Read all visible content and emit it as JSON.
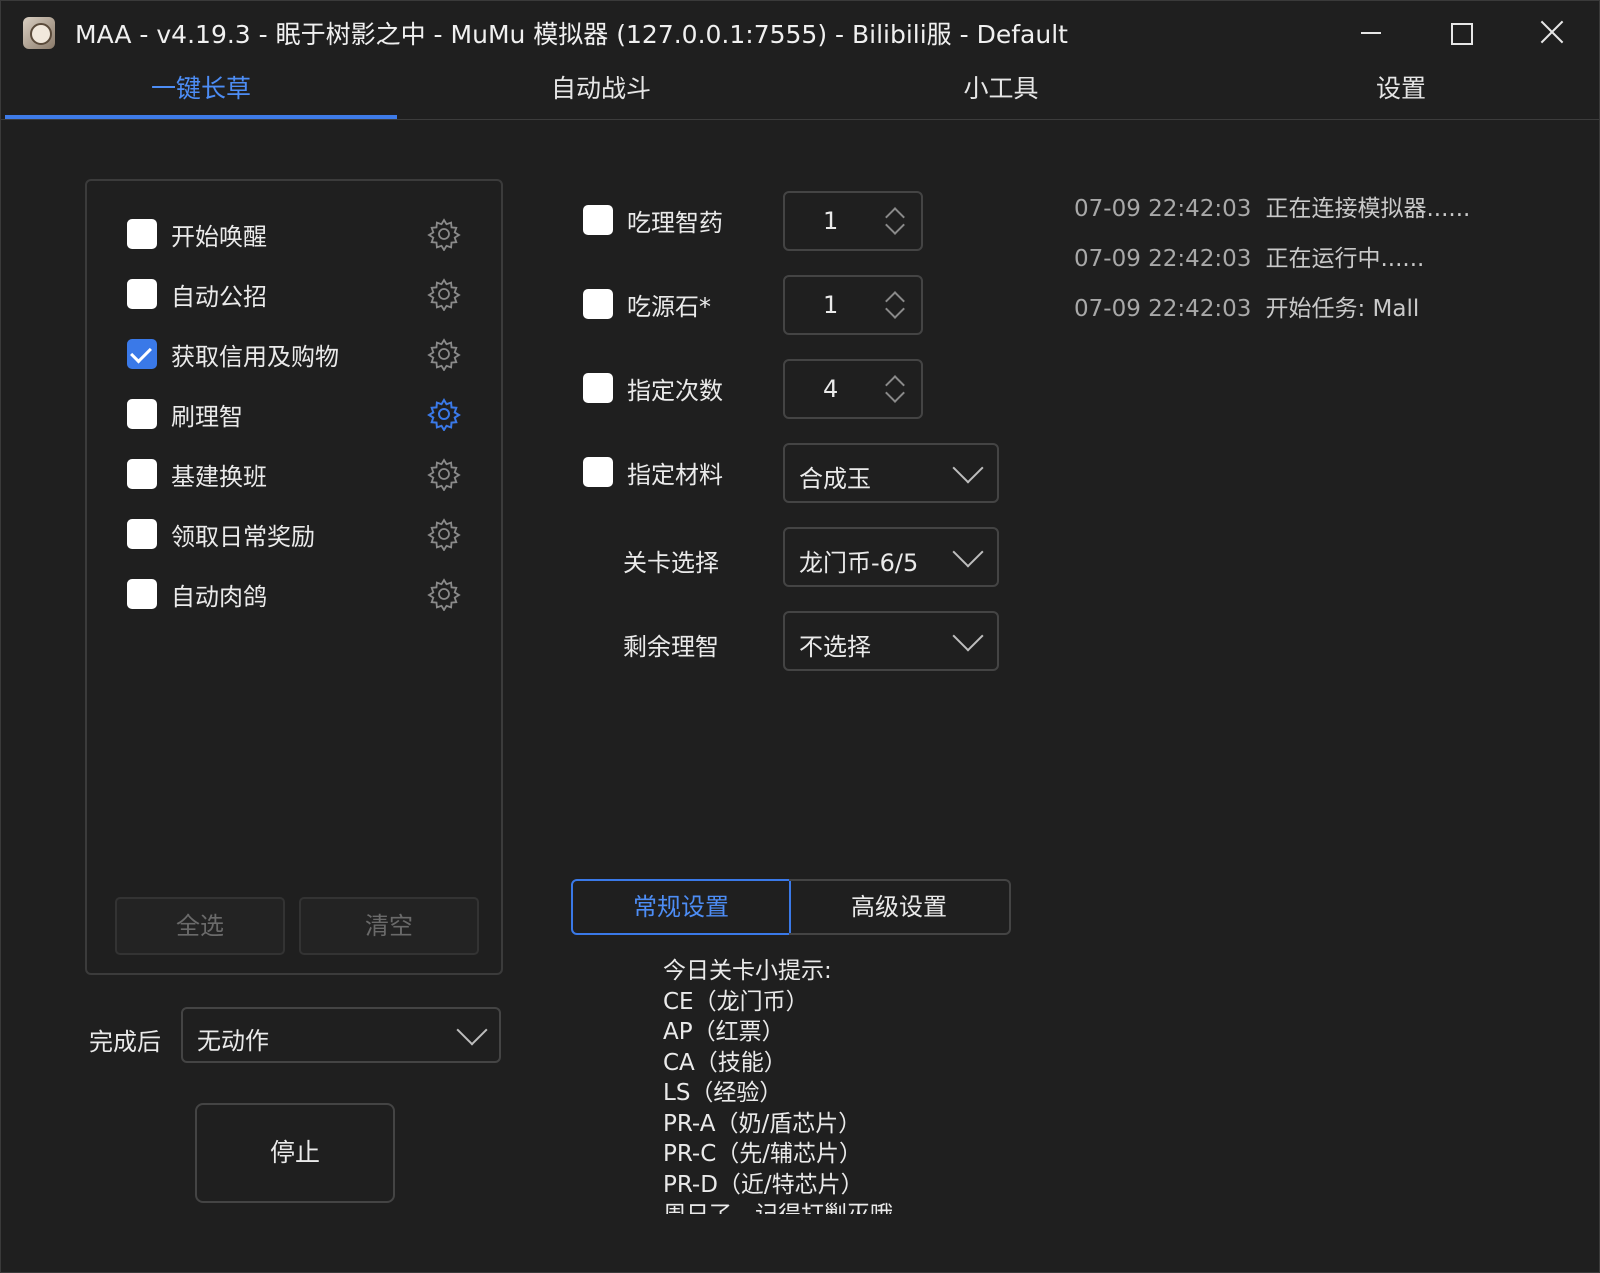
{
  "window": {
    "title": "MAA - v4.19.3 - 眠于树影之中 - MuMu 模拟器 (127.0.0.1:7555) - Bilibili服 - Default",
    "icons": {
      "minimize": "minimize-icon",
      "maximize": "maximize-icon",
      "close": "close-icon"
    }
  },
  "tabs": [
    {
      "label": "一键长草",
      "active": true
    },
    {
      "label": "自动战斗",
      "active": false
    },
    {
      "label": "小工具",
      "active": false
    },
    {
      "label": "设置",
      "active": false
    }
  ],
  "tasks": [
    {
      "label": "开始唤醒",
      "checked": false,
      "gear_active": false
    },
    {
      "label": "自动公招",
      "checked": false,
      "gear_active": false
    },
    {
      "label": "获取信用及购物",
      "checked": true,
      "gear_active": false
    },
    {
      "label": "刷理智",
      "checked": false,
      "gear_active": true
    },
    {
      "label": "基建换班",
      "checked": false,
      "gear_active": false
    },
    {
      "label": "领取日常奖励",
      "checked": false,
      "gear_active": false
    },
    {
      "label": "自动肉鸽",
      "checked": false,
      "gear_active": false
    }
  ],
  "task_buttons": {
    "select_all": "全选",
    "clear": "清空"
  },
  "after_complete": {
    "label": "完成后",
    "value": "无动作"
  },
  "stop_button": "停止",
  "fight": {
    "medicine": {
      "label": "吃理智药",
      "checked": false,
      "value": "1"
    },
    "stone": {
      "label": "吃源石*",
      "checked": false,
      "value": "1"
    },
    "times": {
      "label": "指定次数",
      "checked": false,
      "value": "4"
    },
    "material": {
      "label": "指定材料",
      "checked": false,
      "value": "合成玉"
    },
    "stage": {
      "label": "关卡选择",
      "value": "龙门币-6/5"
    },
    "remaining": {
      "label": "剩余理智",
      "value": "不选择"
    }
  },
  "settings_tabs": {
    "general": "常规设置",
    "advanced": "高级设置"
  },
  "tips": {
    "title": "今日关卡小提示:",
    "lines": [
      "CE（龙门币）",
      "AP（红票）",
      "CA（技能）",
      "LS（经验）",
      "PR-A（奶/盾芯片）",
      "PR-C（先/辅芯片）",
      "PR-D（近/特芯片）",
      "周日了，记得打剿灭哦"
    ]
  },
  "log": [
    {
      "time": "07-09  22:42:03",
      "message": "正在连接模拟器......"
    },
    {
      "time": "07-09  22:42:03",
      "message": "正在运行中......"
    },
    {
      "time": "07-09  22:42:03",
      "message": "开始任务: Mall"
    }
  ],
  "colors": {
    "accent": "#3a79e8",
    "background": "#1f1f1f",
    "border": "#444444"
  }
}
